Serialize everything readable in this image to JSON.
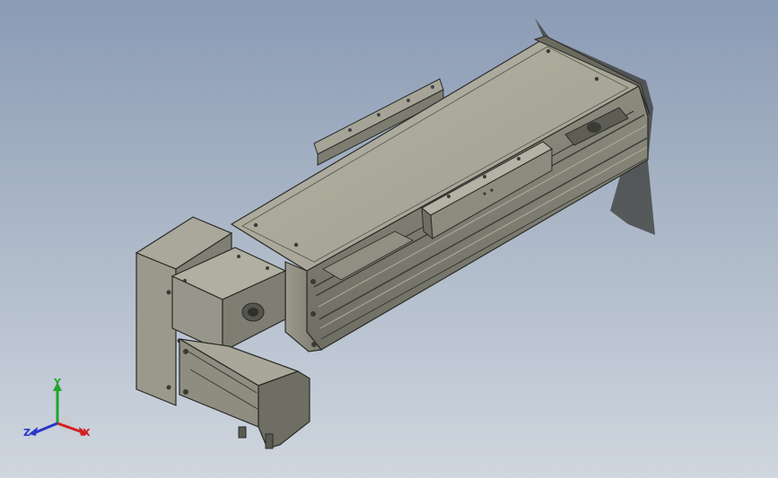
{
  "viewport": {
    "background_top": "#8a9bb5",
    "background_bottom": "#cfd6df",
    "model_face_light": "#aaa99a",
    "model_face_mid": "#8f8e80",
    "model_face_dark": "#6e6d62",
    "edge_color": "#2b2b28"
  },
  "triad": {
    "x_label": "X",
    "y_label": "Y",
    "z_label": "Z",
    "x_color": "#d42020",
    "y_color": "#1fa52a",
    "z_color": "#2a36c8"
  }
}
